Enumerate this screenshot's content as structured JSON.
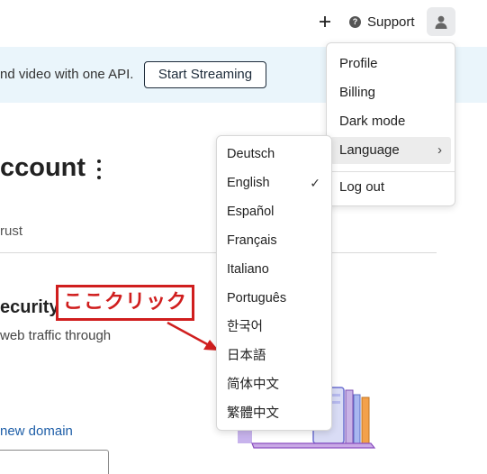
{
  "topbar": {
    "add_icon": "plus-icon",
    "support_label": "Support",
    "support_icon": "help-circle-icon",
    "user_icon": "user-icon"
  },
  "banner": {
    "text": "nd video with one API.",
    "button_label": "Start Streaming"
  },
  "main": {
    "title": "ccount",
    "kebab_icon": "kebab-menu-icon",
    "tab_text": "rust",
    "section_title": "ecurity",
    "section_desc": "web traffic through",
    "domain_link": "new domain"
  },
  "annotation": {
    "text": "ここクリック",
    "color": "#d01e1e"
  },
  "user_menu": {
    "items": [
      {
        "label": "Profile"
      },
      {
        "label": "Billing"
      },
      {
        "label": "Dark mode"
      },
      {
        "label": "Language",
        "submenu_icon": "chevron-right-icon"
      },
      {
        "label": "Log out"
      }
    ],
    "chevron": "›"
  },
  "language_menu": {
    "items": [
      {
        "label": "Deutsch"
      },
      {
        "label": "English",
        "checked": true
      },
      {
        "label": "Español"
      },
      {
        "label": "Français"
      },
      {
        "label": "Italiano"
      },
      {
        "label": "Português"
      },
      {
        "label": "한국어"
      },
      {
        "label": "日本語"
      },
      {
        "label": "简体中文"
      },
      {
        "label": "繁體中文"
      }
    ],
    "check_mark": "✓"
  },
  "colors": {
    "banner_bg": "#eaf5fb",
    "link": "#1f5fa8",
    "annotation_red": "#d01e1e"
  }
}
